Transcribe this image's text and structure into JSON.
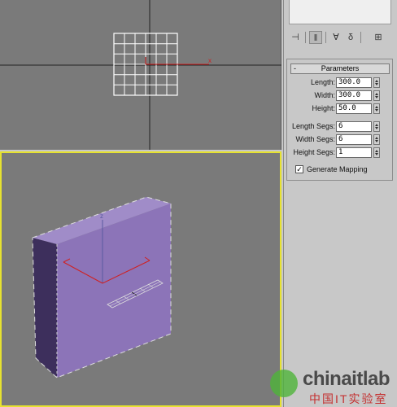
{
  "parameters": {
    "title": "Parameters",
    "collapse": "-",
    "length": {
      "label": "Length:",
      "value": "300.0"
    },
    "width": {
      "label": "Width:",
      "value": "300.0"
    },
    "height": {
      "label": "Height:",
      "value": "50.0"
    },
    "length_segs": {
      "label": "Length Segs:",
      "value": "6"
    },
    "width_segs": {
      "label": "Width Segs:",
      "value": "6"
    },
    "height_segs": {
      "label": "Height Segs:",
      "value": "1"
    },
    "generate_mapping": {
      "label": "Generate Mapping",
      "checked": true,
      "mark": "✓"
    }
  },
  "viewports": {
    "top": {
      "axis_label": "x"
    },
    "perspective": {
      "axis_label": "z"
    }
  },
  "toolbar": {
    "icons": [
      "pin-icon",
      "modifier-stack-icon",
      "funnel-icon",
      "unique-icon",
      "configure-icon"
    ]
  },
  "watermark": {
    "text": "chinaitlab",
    "subtext": "中国IT实验室"
  },
  "colors": {
    "viewport_bg": "#7a7a7a",
    "active_border": "#e6e230",
    "box_face": "#8c74b8",
    "box_side": "#3d2f5c",
    "grid_line": "#ffffff",
    "axis_red": "#d02020",
    "crosshair": "#222222"
  }
}
